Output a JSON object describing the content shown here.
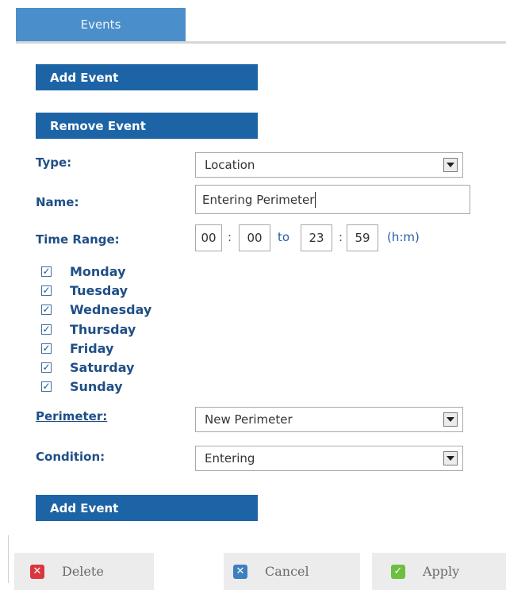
{
  "tab": {
    "label": "Events"
  },
  "sections": {
    "add_event_top": "Add Event",
    "remove_event": "Remove Event",
    "add_event_bottom": "Add Event"
  },
  "form": {
    "type": {
      "label": "Type:",
      "value": "Location"
    },
    "name": {
      "label": "Name:",
      "value": "Entering Perimeter"
    },
    "time_range": {
      "label": "Time Range:",
      "start_hour": "00",
      "start_min": "00",
      "sep": ":",
      "to": "to",
      "end_hour": "23",
      "end_min": "59",
      "unit": "(h:m)"
    },
    "days": [
      {
        "label": "Monday",
        "checked": true
      },
      {
        "label": "Tuesday",
        "checked": true
      },
      {
        "label": "Wednesday",
        "checked": true
      },
      {
        "label": "Thursday",
        "checked": true
      },
      {
        "label": "Friday",
        "checked": true
      },
      {
        "label": "Saturday",
        "checked": true
      },
      {
        "label": "Sunday",
        "checked": true
      }
    ],
    "perimeter": {
      "label": "Perimeter:",
      "value": "New Perimeter"
    },
    "condition": {
      "label": "Condition:",
      "value": "Entering"
    }
  },
  "footer": {
    "delete": {
      "label": "Delete",
      "icon": "x-icon",
      "color": "#d9363e"
    },
    "cancel": {
      "label": "Cancel",
      "icon": "x-icon",
      "color": "#3f7fc0"
    },
    "apply": {
      "label": "Apply",
      "icon": "check-icon",
      "color": "#6cbf3f"
    }
  },
  "colors": {
    "tab": "#4a8fcb",
    "section_header": "#1d64a6",
    "label_text": "#1f4f86"
  }
}
